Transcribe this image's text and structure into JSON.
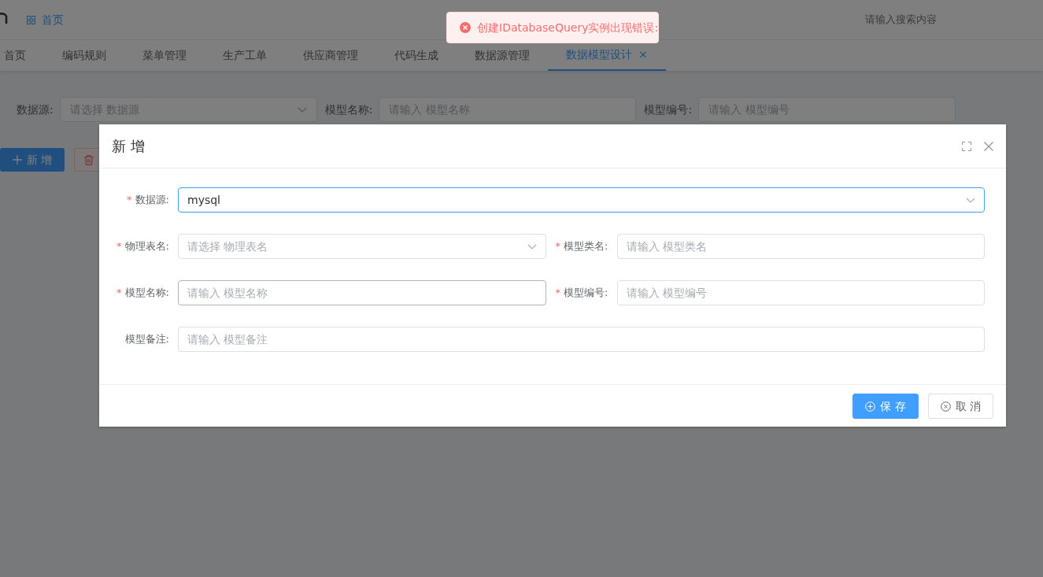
{
  "header": {
    "home_link": "首页",
    "search": {
      "placeholder": "请输入搜索内容"
    }
  },
  "tabs": [
    {
      "label": "首页",
      "selected": false
    },
    {
      "label": "编码规则",
      "selected": false
    },
    {
      "label": "菜单管理",
      "selected": false
    },
    {
      "label": "生产工单",
      "selected": false
    },
    {
      "label": "供应商管理",
      "selected": false
    },
    {
      "label": "代码生成",
      "selected": false
    },
    {
      "label": "数据源管理",
      "selected": false
    },
    {
      "label": "数据模型设计",
      "selected": true,
      "close_icon": "×"
    }
  ],
  "filters": [
    {
      "label": "数据源:",
      "placeholder": "请选择 数据源",
      "kind": "select"
    },
    {
      "label": "模型名称:",
      "placeholder": "请输入 模型名称",
      "kind": "input"
    },
    {
      "label": "模型编号:",
      "placeholder": "请输入 模型编号",
      "kind": "input"
    }
  ],
  "toolbar": {
    "add_button": "新 增"
  },
  "toast": {
    "message": "创建IDatabaseQuery实例出现错误:"
  },
  "dialog": {
    "title": "新 增",
    "rows": [
      [
        {
          "label": "数据源:",
          "required_mark": "*",
          "kind": "select",
          "value": "mysql",
          "focused": true,
          "hovered": false
        }
      ],
      [
        {
          "label": "物理表名:",
          "required_mark": "*",
          "kind": "select",
          "placeholder": "请选择 物理表名",
          "focused": false,
          "hovered": false
        },
        {
          "label": "模型类名:",
          "required_mark": "*",
          "kind": "input",
          "placeholder": "请输入 模型类名",
          "focused": false,
          "hovered": false
        }
      ],
      [
        {
          "label": "模型名称:",
          "required_mark": "*",
          "kind": "input",
          "placeholder": "请输入 模型名称",
          "focused": false,
          "hovered": true
        },
        {
          "label": "模型编号:",
          "required_mark": "*",
          "kind": "input",
          "placeholder": "请输入 模型编号",
          "focused": false,
          "hovered": false
        }
      ],
      [
        {
          "label": "模型备注:",
          "kind": "input",
          "placeholder": "请输入 模型备注",
          "focused": false,
          "hovered": false
        }
      ]
    ],
    "buttons": [
      {
        "label": "保 存",
        "kind": "primary"
      },
      {
        "label": "取 消",
        "kind": "default"
      }
    ]
  }
}
